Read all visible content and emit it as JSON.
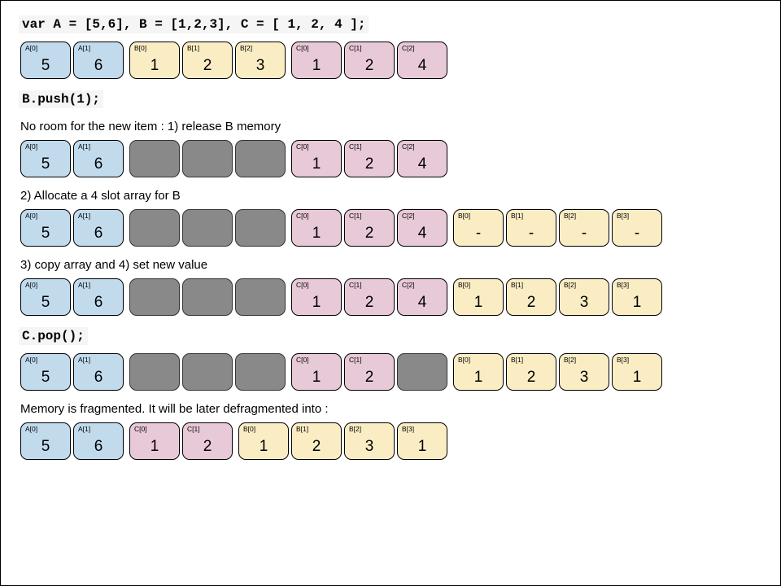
{
  "lines": {
    "decl": "var A = [5,6],  B = [1,2,3], C = [ 1, 2, 4 ];",
    "push": "B.push(1);",
    "noroom": "No room for the new item : 1) release B memory",
    "alloc": "2) Allocate a 4 slot array for B",
    "copy": "3) copy array and 4) set new value",
    "pop": "C.pop();",
    "frag": "Memory is fragmented. It will be later defragmented into :"
  },
  "rows": {
    "r1": [
      {
        "label": "A[0]",
        "value": "5",
        "color": "blue"
      },
      {
        "label": "A[1]",
        "value": "6",
        "color": "blue",
        "gap": true
      },
      {
        "label": "B[0]",
        "value": "1",
        "color": "yellow"
      },
      {
        "label": "B[1]",
        "value": "2",
        "color": "yellow"
      },
      {
        "label": "B[2]",
        "value": "3",
        "color": "yellow",
        "gap": true
      },
      {
        "label": "C[0]",
        "value": "1",
        "color": "pink"
      },
      {
        "label": "C[1]",
        "value": "2",
        "color": "pink"
      },
      {
        "label": "C[2]",
        "value": "4",
        "color": "pink"
      }
    ],
    "r2": [
      {
        "label": "A[0]",
        "value": "5",
        "color": "blue"
      },
      {
        "label": "A[1]",
        "value": "6",
        "color": "blue",
        "gap": true
      },
      {
        "label": "",
        "value": "",
        "color": "gray"
      },
      {
        "label": "",
        "value": "",
        "color": "gray"
      },
      {
        "label": "",
        "value": "",
        "color": "gray",
        "gap": true
      },
      {
        "label": "C[0]",
        "value": "1",
        "color": "pink"
      },
      {
        "label": "C[1]",
        "value": "2",
        "color": "pink"
      },
      {
        "label": "C[2]",
        "value": "4",
        "color": "pink"
      }
    ],
    "r3": [
      {
        "label": "A[0]",
        "value": "5",
        "color": "blue"
      },
      {
        "label": "A[1]",
        "value": "6",
        "color": "blue",
        "gap": true
      },
      {
        "label": "",
        "value": "",
        "color": "gray"
      },
      {
        "label": "",
        "value": "",
        "color": "gray"
      },
      {
        "label": "",
        "value": "",
        "color": "gray",
        "gap": true
      },
      {
        "label": "C[0]",
        "value": "1",
        "color": "pink"
      },
      {
        "label": "C[1]",
        "value": "2",
        "color": "pink"
      },
      {
        "label": "C[2]",
        "value": "4",
        "color": "pink",
        "gap": true
      },
      {
        "label": "B[0]",
        "value": "-",
        "color": "yellow"
      },
      {
        "label": "B[1]",
        "value": "-",
        "color": "yellow"
      },
      {
        "label": "B[2]",
        "value": "-",
        "color": "yellow"
      },
      {
        "label": "B[3]",
        "value": "-",
        "color": "yellow"
      }
    ],
    "r4": [
      {
        "label": "A[0]",
        "value": "5",
        "color": "blue"
      },
      {
        "label": "A[1]",
        "value": "6",
        "color": "blue",
        "gap": true
      },
      {
        "label": "",
        "value": "",
        "color": "gray"
      },
      {
        "label": "",
        "value": "",
        "color": "gray"
      },
      {
        "label": "",
        "value": "",
        "color": "gray",
        "gap": true
      },
      {
        "label": "C[0]",
        "value": "1",
        "color": "pink"
      },
      {
        "label": "C[1]",
        "value": "2",
        "color": "pink"
      },
      {
        "label": "C[2]",
        "value": "4",
        "color": "pink",
        "gap": true
      },
      {
        "label": "B[0]",
        "value": "1",
        "color": "yellow"
      },
      {
        "label": "B[1]",
        "value": "2",
        "color": "yellow"
      },
      {
        "label": "B[2]",
        "value": "3",
        "color": "yellow"
      },
      {
        "label": "B[3]",
        "value": "1",
        "color": "yellow"
      }
    ],
    "r5": [
      {
        "label": "A[0]",
        "value": "5",
        "color": "blue"
      },
      {
        "label": "A[1]",
        "value": "6",
        "color": "blue",
        "gap": true
      },
      {
        "label": "",
        "value": "",
        "color": "gray"
      },
      {
        "label": "",
        "value": "",
        "color": "gray"
      },
      {
        "label": "",
        "value": "",
        "color": "gray",
        "gap": true
      },
      {
        "label": "C[0]",
        "value": "1",
        "color": "pink"
      },
      {
        "label": "C[1]",
        "value": "2",
        "color": "pink"
      },
      {
        "label": "",
        "value": "",
        "color": "gray",
        "gap": true
      },
      {
        "label": "B[0]",
        "value": "1",
        "color": "yellow"
      },
      {
        "label": "B[1]",
        "value": "2",
        "color": "yellow"
      },
      {
        "label": "B[2]",
        "value": "3",
        "color": "yellow"
      },
      {
        "label": "B[3]",
        "value": "1",
        "color": "yellow"
      }
    ],
    "r6": [
      {
        "label": "A[0]",
        "value": "5",
        "color": "blue"
      },
      {
        "label": "A[1]",
        "value": "6",
        "color": "blue",
        "gap": true
      },
      {
        "label": "C[0]",
        "value": "1",
        "color": "pink"
      },
      {
        "label": "C[1]",
        "value": "2",
        "color": "pink",
        "gap": true
      },
      {
        "label": "B[0]",
        "value": "1",
        "color": "yellow"
      },
      {
        "label": "B[1]",
        "value": "2",
        "color": "yellow"
      },
      {
        "label": "B[2]",
        "value": "3",
        "color": "yellow"
      },
      {
        "label": "B[3]",
        "value": "1",
        "color": "yellow"
      }
    ]
  }
}
